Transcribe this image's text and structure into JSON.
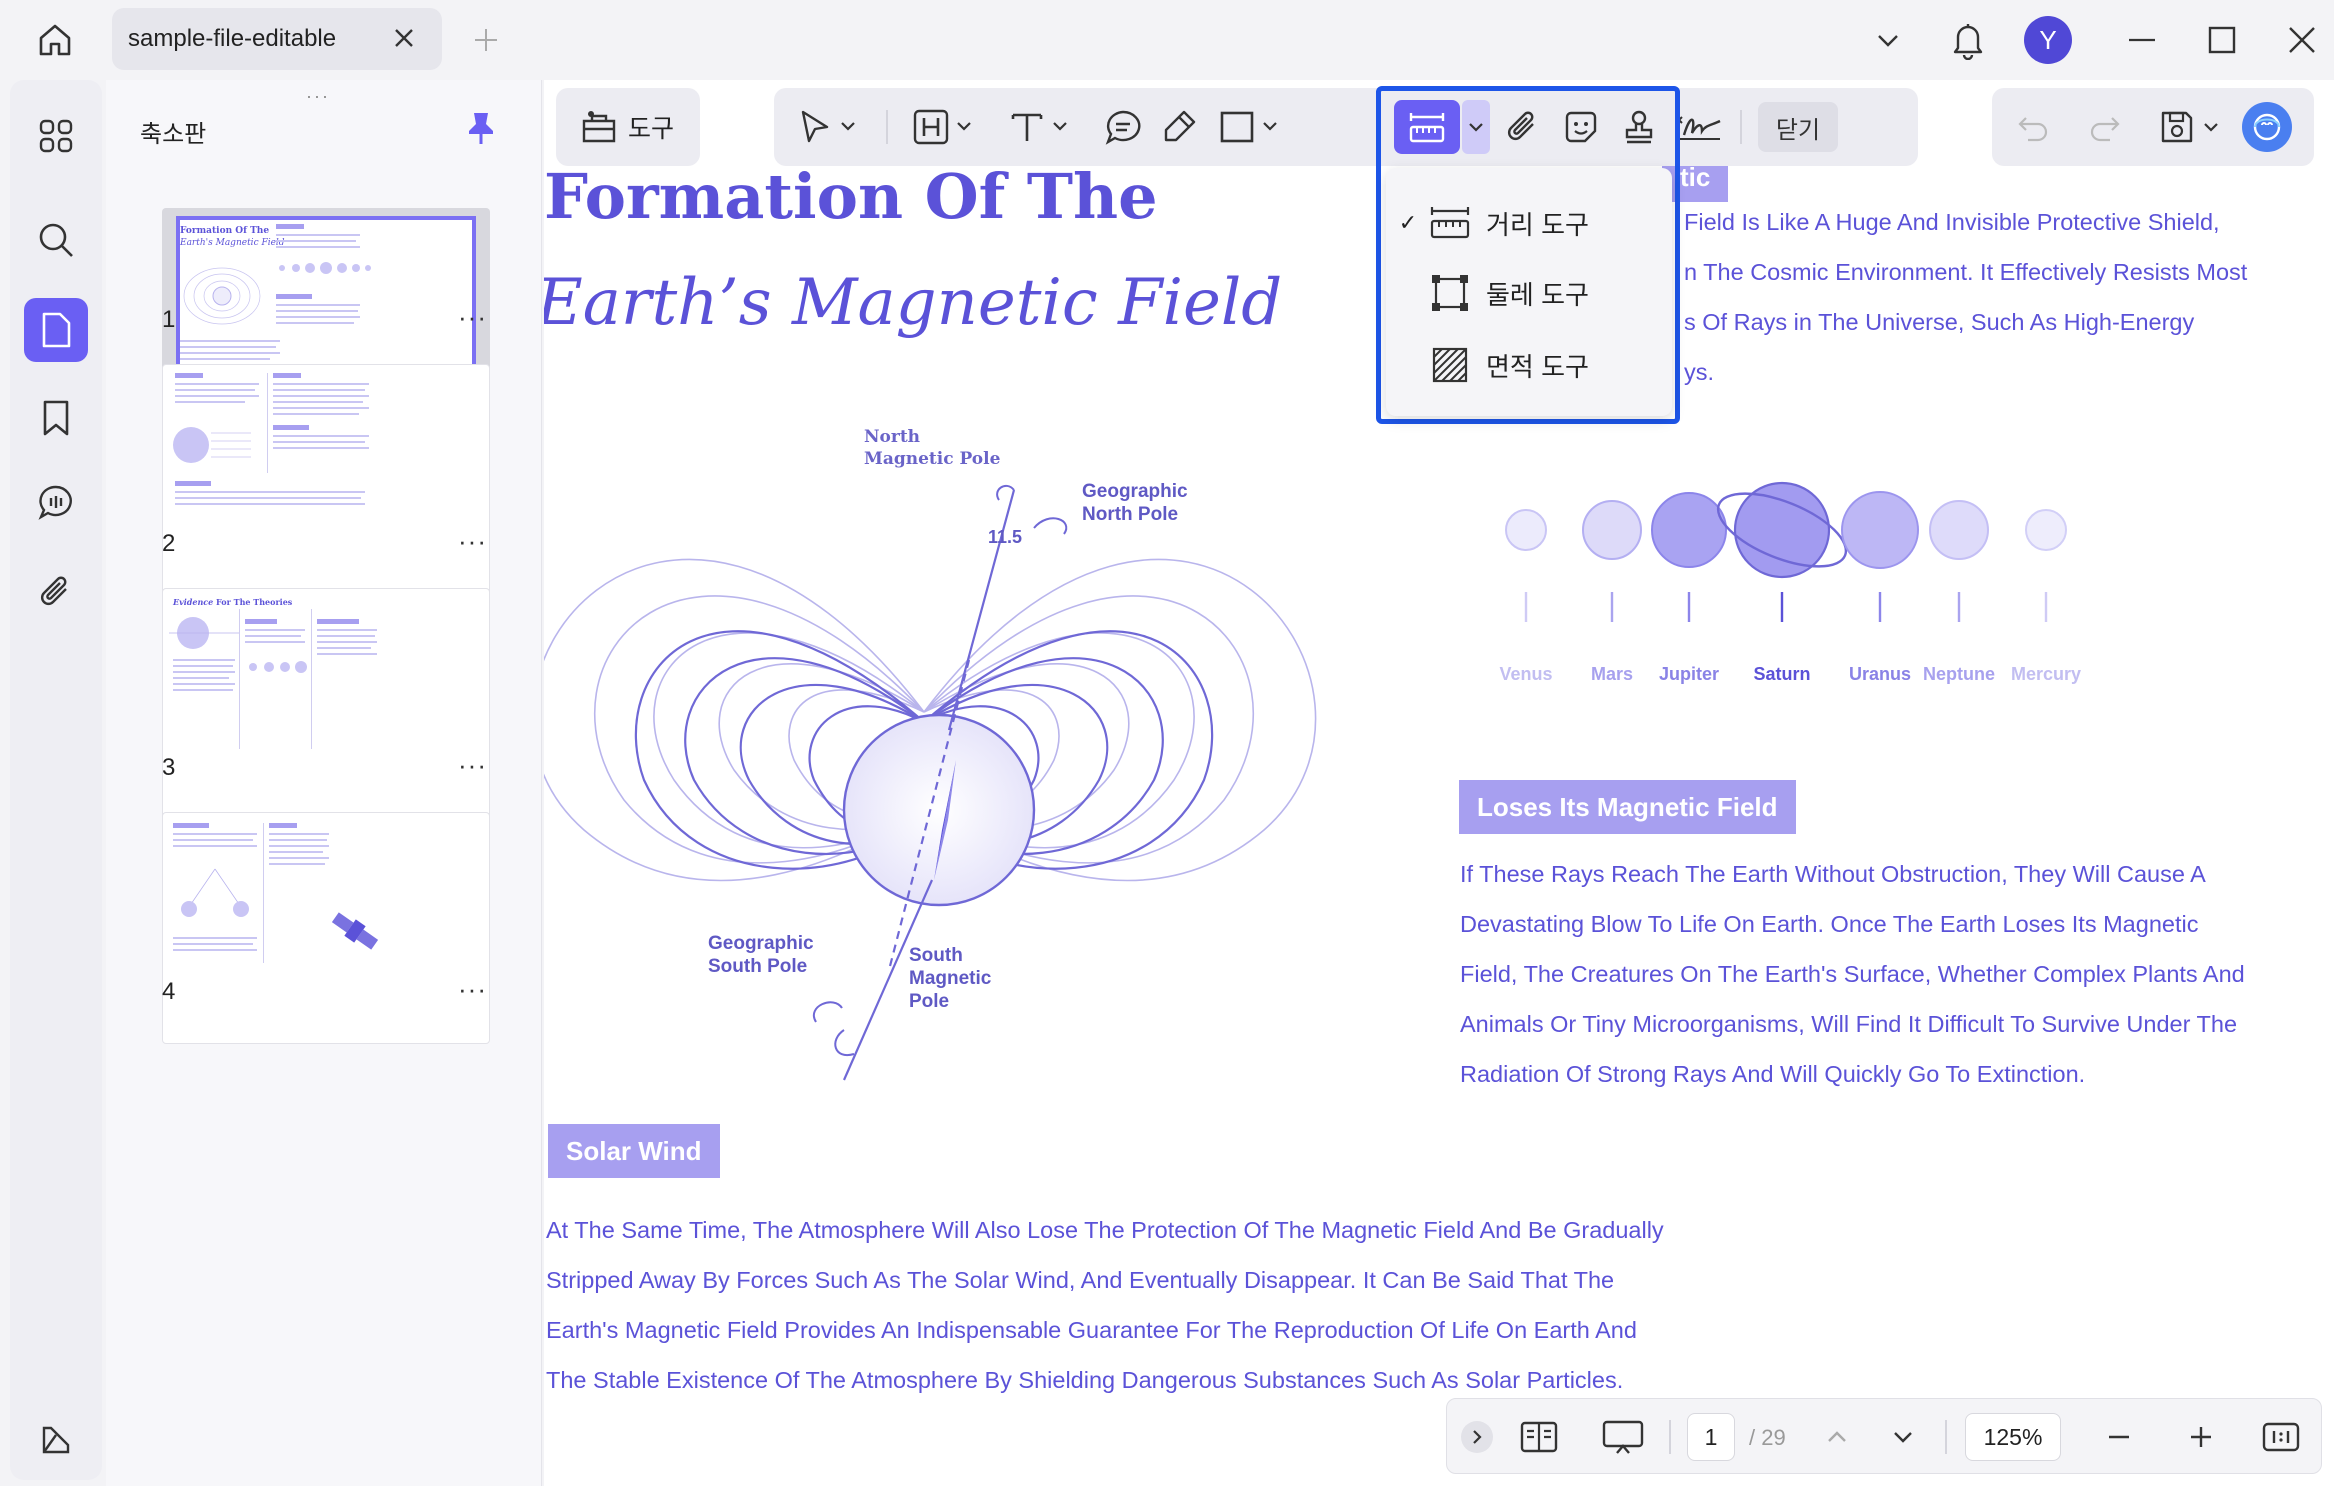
{
  "titlebar": {
    "tab_title": "sample-file-editable",
    "avatar_initial": "Y"
  },
  "thumbnails": {
    "header": "축소판",
    "pages": [
      {
        "number": "1"
      },
      {
        "number": "2"
      },
      {
        "number": "3"
      },
      {
        "number": "4"
      }
    ],
    "more_label": "···",
    "page3_title_em": "Evidence",
    "page3_title_rest": " For The Theories",
    "page1_title_a": "Formation Of The",
    "page1_title_b": "Earth's Magnetic Field"
  },
  "toolbar": {
    "tools_label": "도구",
    "close_label": "닫기"
  },
  "measure_menu": {
    "items": [
      {
        "label": "거리 도구",
        "checked": true
      },
      {
        "label": "둘레 도구",
        "checked": false
      },
      {
        "label": "면적 도구",
        "checked": false
      }
    ],
    "check": "✓"
  },
  "document": {
    "title_line1": "Formation Of The",
    "title_line2": "Earth’s Magnetic Field",
    "partial_badge": "tic",
    "intro_lines": [
      "Field Is Like A Huge And Invisible Protective Shield,",
      "n The Cosmic Environment. It Effectively Resists Most",
      "s Of Rays in The Universe, Such As High-Energy",
      "ys."
    ],
    "diagram": {
      "north_magnetic": [
        "North",
        "Magnetic Pole"
      ],
      "geo_north": [
        "Geographic",
        "North Pole"
      ],
      "geo_south": [
        "Geographic",
        "South Pole"
      ],
      "south_magnetic": [
        "South",
        "Magnetic",
        "Pole"
      ],
      "angle": "11.5"
    },
    "planets": [
      {
        "name": "Venus"
      },
      {
        "name": "Mars"
      },
      {
        "name": "Jupiter"
      },
      {
        "name": "Saturn"
      },
      {
        "name": "Uranus"
      },
      {
        "name": "Neptune"
      },
      {
        "name": "Mercury"
      }
    ],
    "section1_badge": "Loses Its Magnetic Field",
    "section1_lines": [
      "If These Rays Reach The Earth Without Obstruction, They Will Cause A",
      "Devastating Blow To Life On Earth. Once The Earth Loses Its Magnetic",
      "Field, The Creatures On The Earth's Surface, Whether Complex Plants And",
      "Animals Or Tiny Microorganisms, Will Find It Difficult To Survive Under The",
      "Radiation Of Strong Rays And Will Quickly Go To Extinction."
    ],
    "section2_badge": "Solar Wind",
    "section2_lines": [
      "At The Same Time, The Atmosphere Will Also Lose The Protection Of The Magnetic Field And Be Gradually",
      "Stripped Away By Forces Such As The Solar Wind, And Eventually Disappear. It Can Be Said That The",
      "Earth's Magnetic Field Provides An Indispensable Guarantee For The Reproduction Of Life On Earth And",
      "The Stable Existence Of The Atmosphere By Shielding Dangerous Substances Such As Solar Particles."
    ]
  },
  "bottombar": {
    "current_page": "1",
    "total_pages": "/ 29",
    "zoom": "125%"
  },
  "colors": {
    "accent": "#5b52d8",
    "highlight_border": "#1d55e8",
    "rail_active": "#6a5ff3"
  }
}
